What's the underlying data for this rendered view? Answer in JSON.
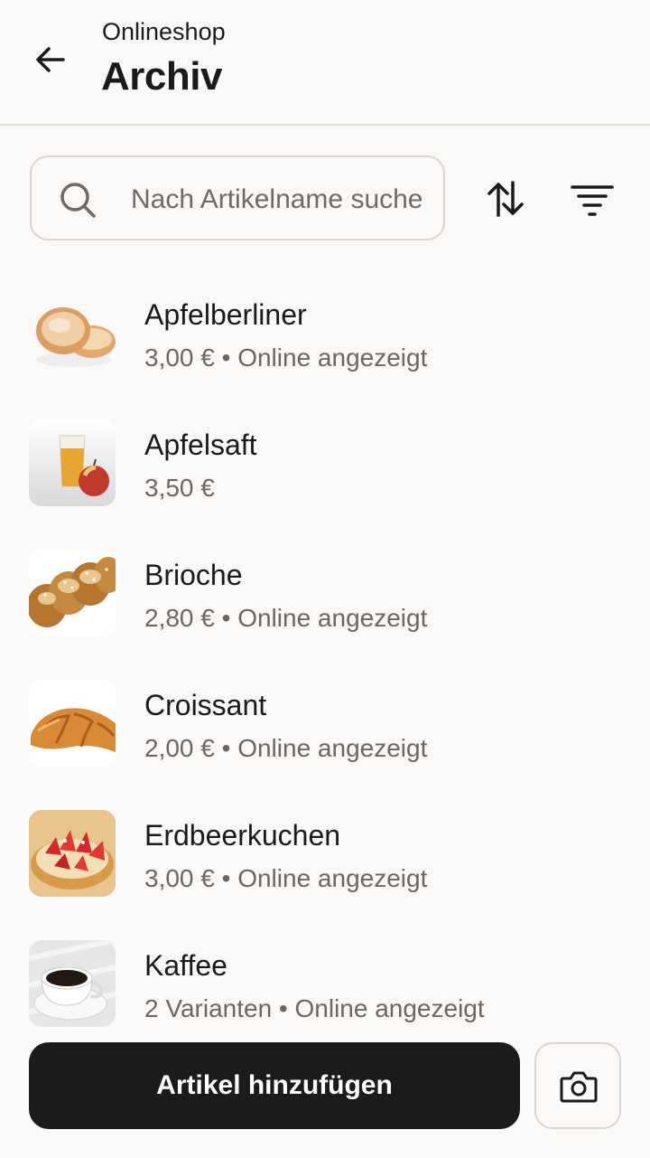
{
  "header": {
    "subtitle": "Onlineshop",
    "title": "Archiv"
  },
  "search": {
    "placeholder": "Nach Artikelname suchen"
  },
  "items": [
    {
      "name": "Apfelberliner",
      "meta": "3,00 € • Online angezeigt",
      "image": "apple-donut-image"
    },
    {
      "name": "Apfelsaft",
      "meta": "3,50 €",
      "image": "apple-juice-image"
    },
    {
      "name": "Brioche",
      "meta": "2,80 € • Online angezeigt",
      "image": "brioche-image"
    },
    {
      "name": "Croissant",
      "meta": "2,00 € • Online angezeigt",
      "image": "croissant-image"
    },
    {
      "name": "Erdbeerkuchen",
      "meta": "3,00 € • Online angezeigt",
      "image": "strawberry-tart-image"
    },
    {
      "name": "Kaffee",
      "meta": "2 Varianten • Online angezeigt",
      "image": "coffee-cup-image"
    }
  ],
  "footer": {
    "add_label": "Artikel hinzufügen"
  },
  "colors": {
    "background": "#faf9f7",
    "primary_button": "#1c1b1a",
    "border": "#d9d6d1",
    "secondary_text": "#6b6763"
  }
}
